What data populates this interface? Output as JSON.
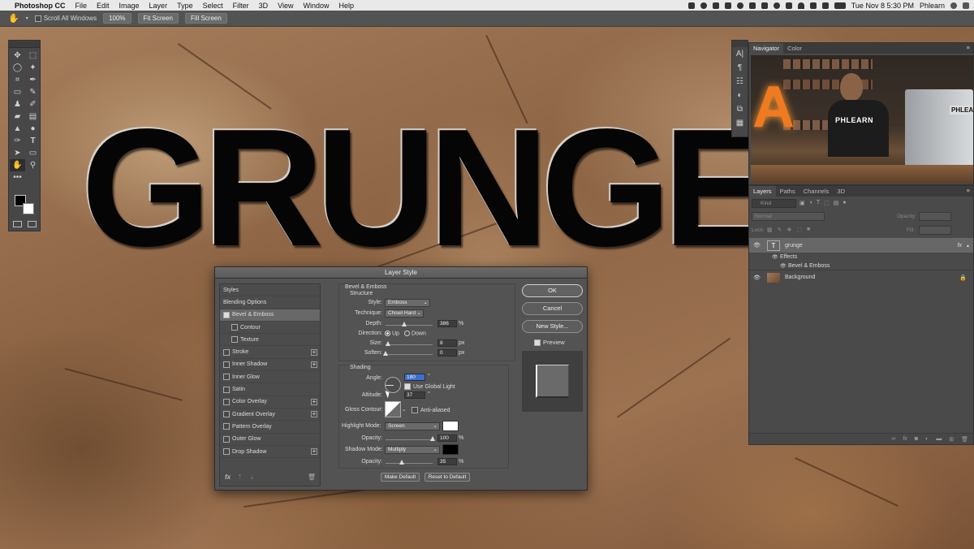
{
  "menubar": {
    "apple": "",
    "app": "Photoshop CC",
    "items": [
      "File",
      "Edit",
      "Image",
      "Layer",
      "Type",
      "Select",
      "Filter",
      "3D",
      "View",
      "Window",
      "Help"
    ],
    "clock": "Tue Nov 8  5:30 PM",
    "user": "Phlearn"
  },
  "options": {
    "scroll_all": "Scroll All Windows",
    "zoom": "100%",
    "fit": "Fit Screen",
    "fill": "Fill Screen"
  },
  "canvas": {
    "text": "GRUNGE"
  },
  "navigator": {
    "tabs": [
      "Navigator",
      "Color"
    ],
    "poster_text": "PHLEARN",
    "shirt_text": "PHLEARN",
    "sign_letter": "A"
  },
  "layers": {
    "tabs": [
      "Layers",
      "Paths",
      "Channels",
      "3D"
    ],
    "kind": "Kind",
    "blend": "Normal",
    "opacity_label": "Opacity:",
    "lock_label": "Lock:",
    "fill_label": "Fill:",
    "items": [
      {
        "name": "grunge",
        "type": "T"
      },
      {
        "name": "Effects"
      },
      {
        "name": "Bevel & Emboss"
      },
      {
        "name": "Background"
      }
    ],
    "fx": "fx"
  },
  "dialog": {
    "title": "Layer Style",
    "styles": [
      {
        "label": "Styles"
      },
      {
        "label": "Blending Options"
      },
      {
        "label": "Bevel & Emboss",
        "checked": true,
        "selected": true
      },
      {
        "label": "Contour",
        "sub": true
      },
      {
        "label": "Texture",
        "sub": true
      },
      {
        "label": "Stroke",
        "plus": true
      },
      {
        "label": "Inner Shadow",
        "plus": true
      },
      {
        "label": "Inner Glow"
      },
      {
        "label": "Satin"
      },
      {
        "label": "Color Overlay",
        "plus": true
      },
      {
        "label": "Gradient Overlay",
        "plus": true
      },
      {
        "label": "Pattern Overlay"
      },
      {
        "label": "Outer Glow"
      },
      {
        "label": "Drop Shadow",
        "plus": true
      }
    ],
    "footer_fx": "fx",
    "structure": {
      "section": "Bevel & Emboss",
      "sub": "Structure",
      "style_label": "Style:",
      "style_value": "Emboss",
      "technique_label": "Technique:",
      "technique_value": "Chisel Hard",
      "depth_label": "Depth:",
      "depth_value": "386",
      "depth_unit": "%",
      "depth_pct": 0.39,
      "direction_label": "Direction:",
      "up": "Up",
      "down": "Down",
      "size_label": "Size:",
      "size_value": "8",
      "size_unit": "px",
      "size_pct": 0.05,
      "soften_label": "Soften:",
      "soften_value": "0",
      "soften_unit": "px",
      "soften_pct": 0.0
    },
    "shading": {
      "section": "Shading",
      "angle_label": "Angle:",
      "angle_value": "180",
      "angle_unit": "°",
      "global_light": "Use Global Light",
      "altitude_label": "Altitude:",
      "altitude_value": "37",
      "altitude_unit": "°",
      "gloss_label": "Gloss Contour:",
      "anti_aliased": "Anti-aliased",
      "highlight_label": "Highlight Mode:",
      "highlight_value": "Screen",
      "highlight_color": "#ffffff",
      "hl_opacity_label": "Opacity:",
      "hl_opacity_value": "100",
      "hl_opacity_unit": "%",
      "hl_opacity_pct": 1.0,
      "shadow_label": "Shadow Mode:",
      "shadow_value": "Multiply",
      "shadow_color": "#000000",
      "sh_opacity_label": "Opacity:",
      "sh_opacity_value": "35",
      "sh_opacity_unit": "%",
      "sh_opacity_pct": 0.35
    },
    "make_default": "Make Default",
    "reset_default": "Reset to Default",
    "buttons": {
      "ok": "OK",
      "cancel": "Cancel",
      "new_style": "New Style...",
      "preview": "Preview"
    }
  }
}
